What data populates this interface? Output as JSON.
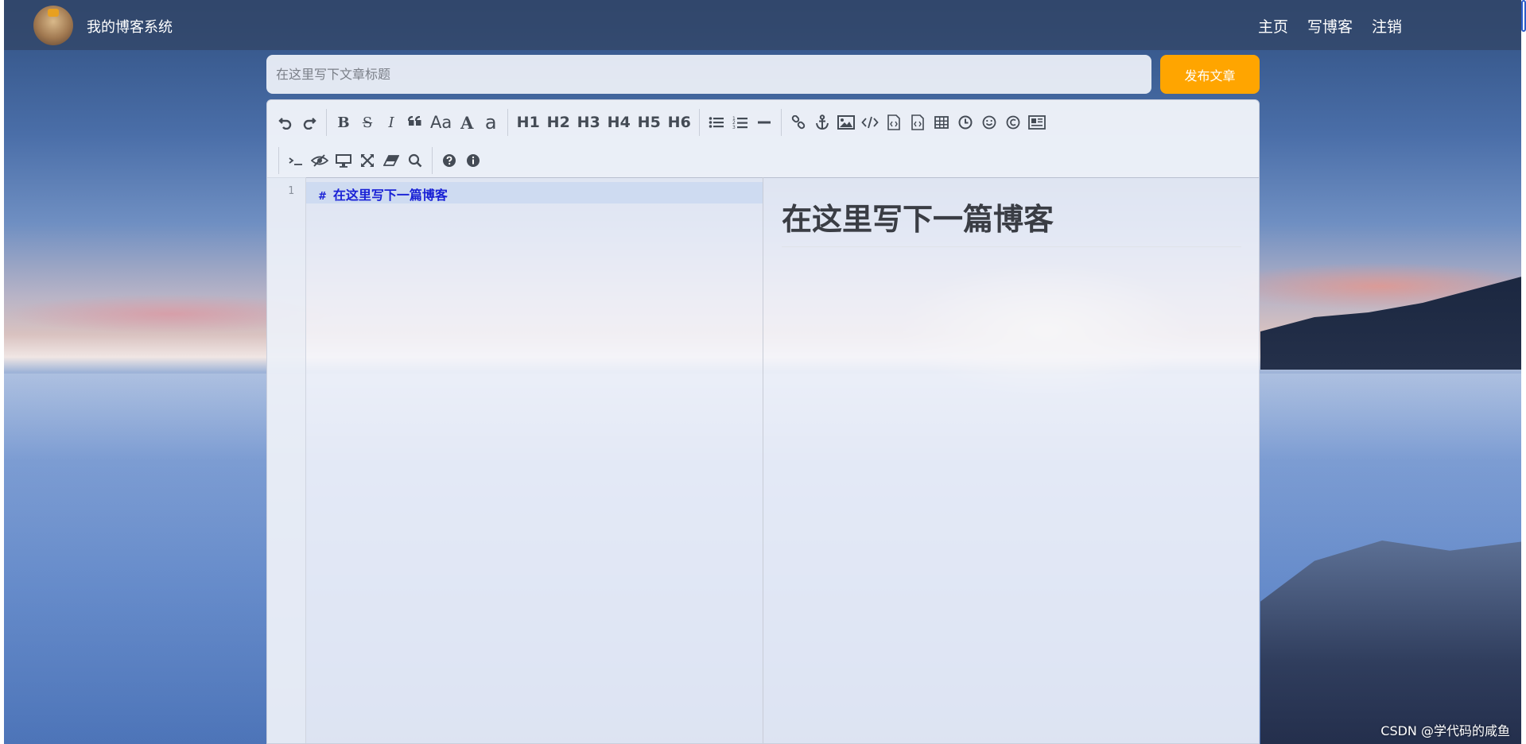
{
  "nav": {
    "brand": "我的博客系统",
    "links": [
      "主页",
      "写博客",
      "注销"
    ]
  },
  "editor_header": {
    "title_placeholder": "在这里写下文章标题",
    "publish_label": "发布文章"
  },
  "toolbar": {
    "row1": [
      {
        "icon": "undo-icon"
      },
      {
        "icon": "redo-icon"
      },
      {
        "sep": true
      },
      {
        "label": "B",
        "icon": "bold-icon"
      },
      {
        "label": "S",
        "icon": "strikethrough-icon"
      },
      {
        "label": "I",
        "icon": "italic-icon"
      },
      {
        "icon": "quote-icon"
      },
      {
        "label": "Aa",
        "icon": "uppercase-icon"
      },
      {
        "label": "A",
        "icon": "font-uppercase-icon"
      },
      {
        "label": "a",
        "icon": "font-lowercase-icon"
      },
      {
        "sep": true
      },
      {
        "label": "H1",
        "icon": "heading-1-icon"
      },
      {
        "label": "H2",
        "icon": "heading-2-icon"
      },
      {
        "label": "H3",
        "icon": "heading-3-icon"
      },
      {
        "label": "H4",
        "icon": "heading-4-icon"
      },
      {
        "label": "H5",
        "icon": "heading-5-icon"
      },
      {
        "label": "H6",
        "icon": "heading-6-icon"
      },
      {
        "sep": true
      },
      {
        "icon": "unordered-list-icon"
      },
      {
        "icon": "ordered-list-icon"
      },
      {
        "icon": "horizontal-rule-icon"
      },
      {
        "sep": true
      },
      {
        "icon": "link-icon"
      },
      {
        "icon": "anchor-icon"
      },
      {
        "icon": "image-icon"
      },
      {
        "icon": "code-icon"
      },
      {
        "icon": "preformatted-code-icon"
      },
      {
        "icon": "code-block-icon"
      },
      {
        "icon": "table-icon"
      },
      {
        "icon": "datetime-icon"
      },
      {
        "icon": "emoji-icon"
      },
      {
        "icon": "html-entities-icon"
      },
      {
        "icon": "pagebreak-icon"
      }
    ],
    "row2": [
      {
        "icon": "goto-line-icon"
      },
      {
        "icon": "unwatch-icon"
      },
      {
        "icon": "preview-icon"
      },
      {
        "icon": "fullscreen-icon"
      },
      {
        "icon": "clear-icon"
      },
      {
        "icon": "search-icon"
      },
      {
        "sep": true
      },
      {
        "icon": "help-icon"
      },
      {
        "icon": "info-icon"
      }
    ]
  },
  "document": {
    "line_number": "1",
    "hash": "#",
    "markdown_text": "在这里写下一篇博客",
    "preview_heading": "在这里写下一篇博客"
  },
  "watermark": "CSDN @学代码的咸鱼"
}
